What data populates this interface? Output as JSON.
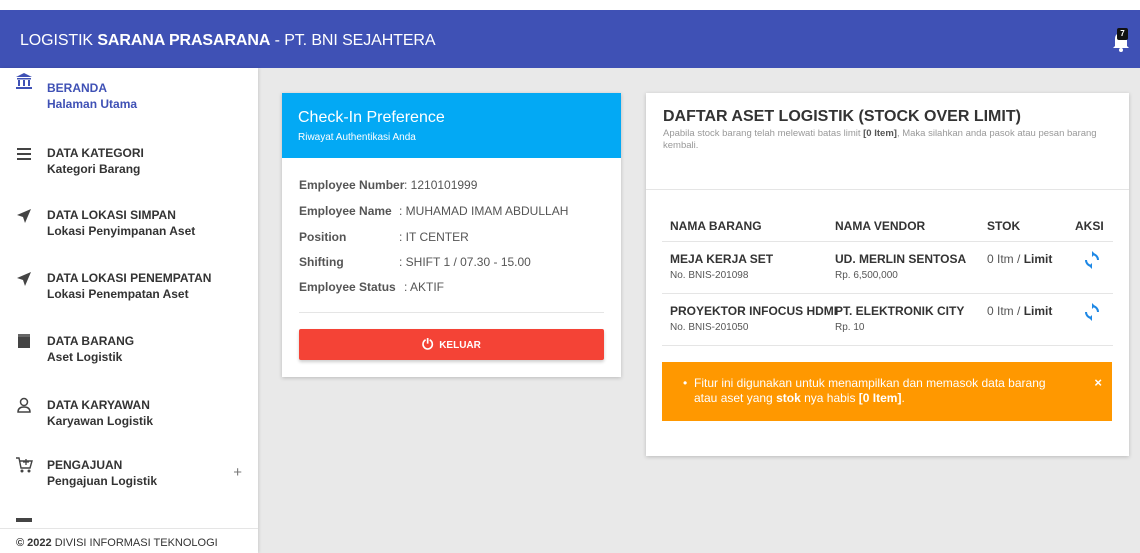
{
  "header": {
    "title_prefix": "LOGISTIK ",
    "title_bold": "SARANA PRASARANA",
    "title_suffix": " - PT. BNI SEJAHTERA",
    "notif_count": "7"
  },
  "sidebar": {
    "items": [
      {
        "icon": "bank-icon",
        "title": "BERANDA",
        "subtitle": "Halaman Utama",
        "active": true
      },
      {
        "icon": "list-icon",
        "title": "DATA KATEGORI",
        "subtitle": "Kategori Barang"
      },
      {
        "icon": "send-icon",
        "title": "DATA LOKASI SIMPAN",
        "subtitle": "Lokasi Penyimpanan Aset"
      },
      {
        "icon": "send-icon",
        "title": "DATA LOKASI PENEMPATAN",
        "subtitle": "Lokasi Penempatan Aset"
      },
      {
        "icon": "box-icon",
        "title": "DATA BARANG",
        "subtitle": "Aset Logistik"
      },
      {
        "icon": "person-icon",
        "title": "DATA KARYAWAN",
        "subtitle": "Karyawan Logistik"
      },
      {
        "icon": "cart-icon",
        "title": "PENGAJUAN",
        "subtitle": "Pengajuan Logistik",
        "expand": "+"
      }
    ],
    "footer_year": "© 2022",
    "footer_text": " DIVISI INFORMASI TEKNOLOGI"
  },
  "checkin": {
    "title": "Check-In Preference",
    "subtitle": "Riwayat Authentikasi Anda",
    "rows": [
      {
        "label": "Employee Number",
        "value": ": 1210101999"
      },
      {
        "label": "Employee Name",
        "value": ": MUHAMAD IMAM ABDULLAH"
      },
      {
        "label": "Position",
        "value": ": IT CENTER"
      },
      {
        "label": "Shifting",
        "value": ": SHIFT 1 / 07.30 - 15.00"
      },
      {
        "label": "Employee Status",
        "value": ": AKTIF"
      }
    ],
    "logout_label": "KELUAR"
  },
  "stock": {
    "title": "DAFTAR ASET LOGISTIK (STOCK OVER LIMIT)",
    "desc_pre": "Apabila stock barang telah melewati batas limit ",
    "desc_bold": "[0 Item]",
    "desc_post": ", Maka silahkan anda pasok atau pesan barang kembali.",
    "columns": [
      "NAMA BARANG",
      "NAMA VENDOR",
      "STOK",
      "AKSI"
    ],
    "rows": [
      {
        "name": "MEJA KERJA SET",
        "code": "No. BNIS-201098",
        "vendor": "UD. MERLIN SENTOSA",
        "price": "Rp. 6,500,000",
        "qty": "0 Itm / ",
        "limit": "Limit"
      },
      {
        "name": "PROYEKTOR INFOCUS HDMI",
        "code": "No. BNIS-201050",
        "vendor": "PT. ELEKTRONIK CITY",
        "price": "Rp. 10",
        "qty": "0 Itm / ",
        "limit": "Limit"
      }
    ],
    "alert_pre": "Fitur ini digunakan untuk menampilkan dan memasok data barang atau aset yang ",
    "alert_bold1": "stok",
    "alert_mid": " nya habis ",
    "alert_bold2": "[0 Item]",
    "alert_post": ".",
    "alert_bullet": "•",
    "alert_close": "×"
  }
}
